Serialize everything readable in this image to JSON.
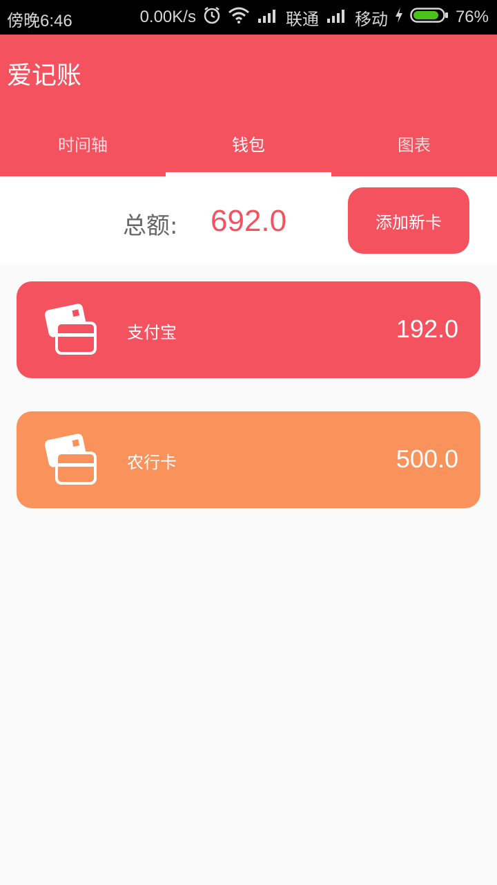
{
  "status_bar": {
    "time": "傍晚6:46",
    "net_speed": "0.00K/s",
    "carrier1": "联通",
    "carrier2": "移动",
    "battery": "76%",
    "icons": [
      "alarm-icon",
      "wifi-icon",
      "signal-icon",
      "charging-icon",
      "battery-icon"
    ]
  },
  "app": {
    "title": "爱记账",
    "accent_color": "#f4525e"
  },
  "tabs": [
    {
      "label": "时间轴",
      "active": false
    },
    {
      "label": "钱包",
      "active": true
    },
    {
      "label": "图表",
      "active": false
    }
  ],
  "wallet": {
    "total_label": "总额:",
    "total_value": "692.0",
    "add_card_label": "添加新卡"
  },
  "cards": [
    {
      "name": "支付宝",
      "amount": "192.0",
      "color": "#f4525e",
      "icon": "cards-icon"
    },
    {
      "name": "农行卡",
      "amount": "500.0",
      "color": "#f9935b",
      "icon": "cards-icon"
    }
  ]
}
